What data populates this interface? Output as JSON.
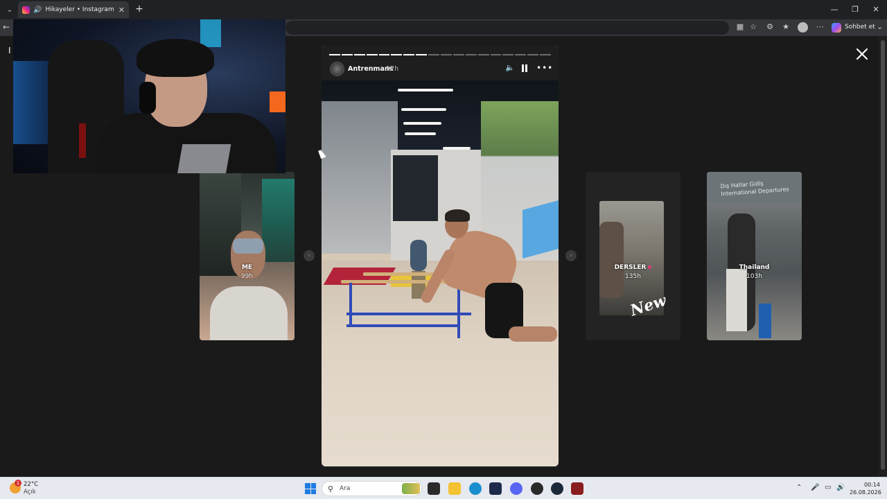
{
  "browser": {
    "tab_title": "Hikayeler • Instagram",
    "chat_label": "Sohbet et"
  },
  "story": {
    "username": "Antrenmans",
    "age": "92h",
    "progress": {
      "segments": 18,
      "completed": 8
    }
  },
  "side_stories": [
    {
      "label": "ME",
      "time": "99h"
    },
    {
      "label": "DERSLER",
      "time": "135h",
      "sticker": "New"
    },
    {
      "label": "Thailand",
      "time": "103h",
      "sign": "Dış Hatlar Gidiş\nInternational Departures"
    }
  ],
  "taskbar": {
    "temperature": "22°C",
    "condition": "Açık",
    "weather_badge": "1",
    "search_placeholder": "Ara",
    "time": "00:14",
    "date": "26.08.2026"
  },
  "colors": {
    "instagram_accent": "#ee2a7b",
    "windows_blue": "#1f7ce0",
    "page_bg": "#1a1a1a"
  }
}
